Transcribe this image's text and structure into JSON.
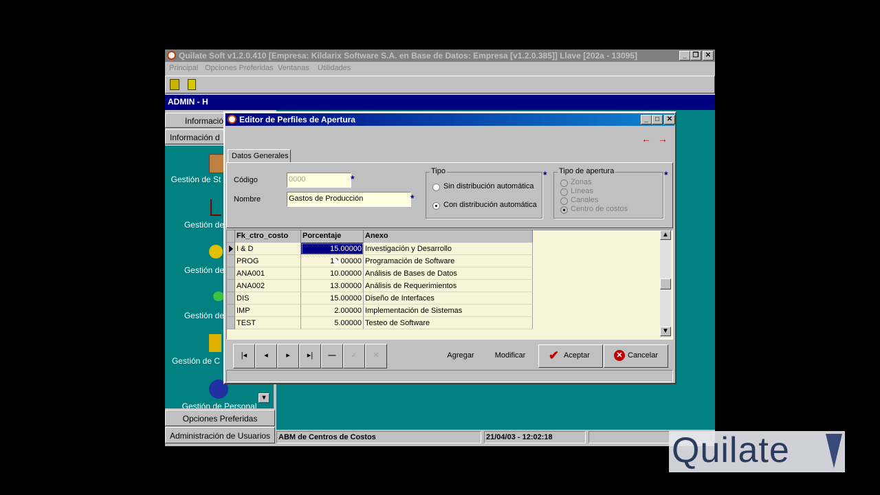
{
  "app": {
    "title": "Quilate Soft v1.2.0.410 [Empresa: Kildarix Software S.A. en Base de Datos: Empresa [v1.2.0.385]]  Llave [202a - 13095]",
    "menu": [
      "Principal",
      "Opciones Preferidas",
      "Ventanas",
      "Utilidades"
    ],
    "user": "ADMIN - H",
    "side_tab_top_1": "Información",
    "side_tab_top_2": "Información d",
    "side_items": [
      "Gestión de St",
      "Gestión de",
      "Gestión de",
      "Gestión de",
      "Gestión de C",
      "Gestión de Personal"
    ],
    "side_bottom_1": "Opciones Preferidas",
    "side_bottom_2": "Administración de Usuarios",
    "status": {
      "left": "ABM de Centros de Costos",
      "datetime": "21/04/03 - 12:02:18",
      "extra": ""
    }
  },
  "dialog": {
    "title": "Editor de Perfiles de Apertura",
    "tab": "Datos Generales",
    "codigo_label": "Código",
    "codigo_value": "0000",
    "nombre_label": "Nombre",
    "nombre_value": "Gastos de Producción",
    "tipo": {
      "legend": "Tipo",
      "options": [
        "Sin distribución automática",
        "Con distribución automática"
      ],
      "selected": "Con distribución automática"
    },
    "tipo_apertura": {
      "legend": "Tipo de apertura",
      "options": [
        "Zonas",
        "Líneas",
        "Canales",
        "Centro de costos"
      ],
      "selected": "Centro de costos"
    },
    "grid": {
      "columns": [
        "Fk_ctro_costo",
        "Porcentaje",
        "Anexo"
      ],
      "rows": [
        [
          "I & D",
          "15.00000",
          "Investigación y Desarrollo"
        ],
        [
          "PROG",
          "10.00000",
          "Programación de Software"
        ],
        [
          "ANA001",
          "10.00000",
          "Análisis de Bases de Datos"
        ],
        [
          "ANA002",
          "13.00000",
          "Análisis de Requerimientos"
        ],
        [
          "DIS",
          "15.00000",
          "Diseño de Interfaces"
        ],
        [
          "IMP",
          "2.00000",
          "Implementación de Sistemas"
        ],
        [
          "TEST",
          "5.00000",
          "Testeo de Software"
        ]
      ]
    },
    "buttons": {
      "agregar": "Agregar",
      "modificar": "Modificar",
      "aceptar": "Aceptar",
      "cancelar": "Cancelar"
    }
  },
  "watermark": "Quilate"
}
